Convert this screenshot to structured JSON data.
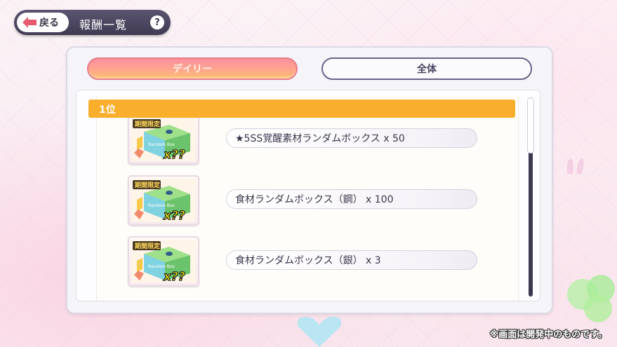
{
  "header": {
    "back_label": "戻る",
    "title": "報酬一覧",
    "help_label": "?"
  },
  "tabs": [
    {
      "label": "デイリー",
      "selected": true
    },
    {
      "label": "全体",
      "selected": false
    }
  ],
  "ranking": {
    "rank_label": "1位",
    "rewards": [
      {
        "name": "★5SS覚醒素材ランダムボックス x 50",
        "badge": "期間限定",
        "qty": "x??",
        "box_label": "Random Box"
      },
      {
        "name": "食材ランダムボックス（鋼） x 100",
        "badge": "期間限定",
        "qty": "x??",
        "box_label": "Random Box"
      },
      {
        "name": "食材ランダムボックス（銀） x 3",
        "badge": "期間限定",
        "qty": "x??",
        "box_label": "Random Box"
      }
    ]
  },
  "footer_note": "※画面は開発中のものです。",
  "colors": {
    "accent_orange": "#f9ae2c",
    "tab_active_start": "#ff8fa0",
    "tab_active_end": "#ffc26f",
    "topbar": "#4a4460",
    "back_arrow": "#e85a6e"
  },
  "icons": {
    "back": "left-arrow-icon",
    "help": "question-icon",
    "reward": "random-box-icon"
  }
}
